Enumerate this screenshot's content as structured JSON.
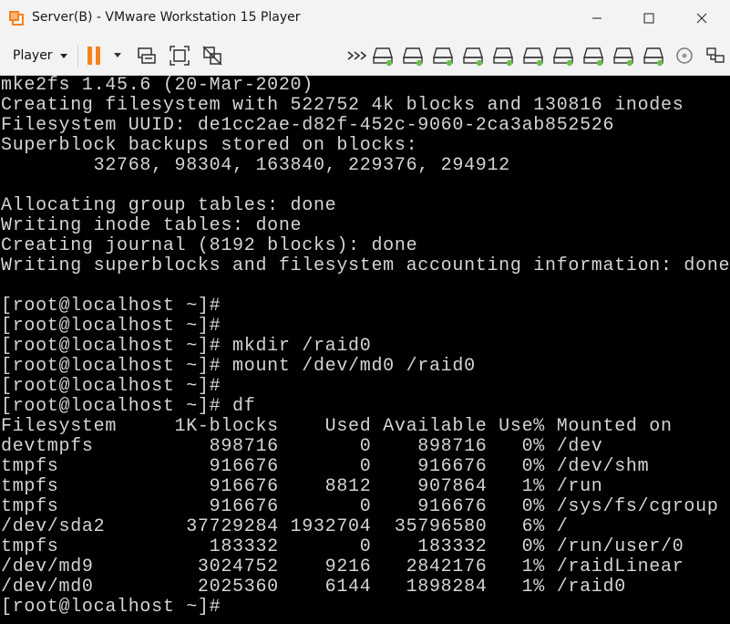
{
  "window": {
    "title": "Server(B) - VMware Workstation 15 Player",
    "accent_color": "#f5821f"
  },
  "toolbar": {
    "player_label": "Player",
    "buttons": [
      "pause-icon",
      "send-keys-icon",
      "fit-guest-icon",
      "unity-icon"
    ],
    "devices": [
      "hard-disk-1",
      "hard-disk-2",
      "hard-disk-3",
      "hard-disk-4",
      "hard-disk-5",
      "hard-disk-6",
      "hard-disk-7",
      "hard-disk-8",
      "hard-disk-9",
      "hard-disk-10",
      "cd-dvd",
      "network-adapter"
    ],
    "device_status_color": "#6cc04a"
  },
  "terminal": {
    "lines": [
      "mke2fs 1.45.6 (20-Mar-2020)",
      "Creating filesystem with 522752 4k blocks and 130816 inodes",
      "Filesystem UUID: de1cc2ae-d82f-452c-9060-2ca3ab852526",
      "Superblock backups stored on blocks:",
      "        32768, 98304, 163840, 229376, 294912",
      "",
      "Allocating group tables: done",
      "Writing inode tables: done",
      "Creating journal (8192 blocks): done",
      "Writing superblocks and filesystem accounting information: done",
      "",
      "[root@localhost ~]#",
      "[root@localhost ~]#",
      "[root@localhost ~]# mkdir /raid0",
      "[root@localhost ~]# mount /dev/md0 /raid0",
      "[root@localhost ~]#",
      "[root@localhost ~]# df",
      "Filesystem     1K-blocks    Used Available Use% Mounted on",
      "devtmpfs          898716       0    898716   0% /dev",
      "tmpfs             916676       0    916676   0% /dev/shm",
      "tmpfs             916676    8812    907864   1% /run",
      "tmpfs             916676       0    916676   0% /sys/fs/cgroup",
      "/dev/sda2       37729284 1932704  35796580   6% /",
      "tmpfs             183332       0    183332   0% /run/user/0",
      "/dev/md9         3024752    9216   2842176   1% /raidLinear",
      "/dev/md0         2025360    6144   1898284   1% /raid0",
      "[root@localhost ~]#"
    ]
  }
}
